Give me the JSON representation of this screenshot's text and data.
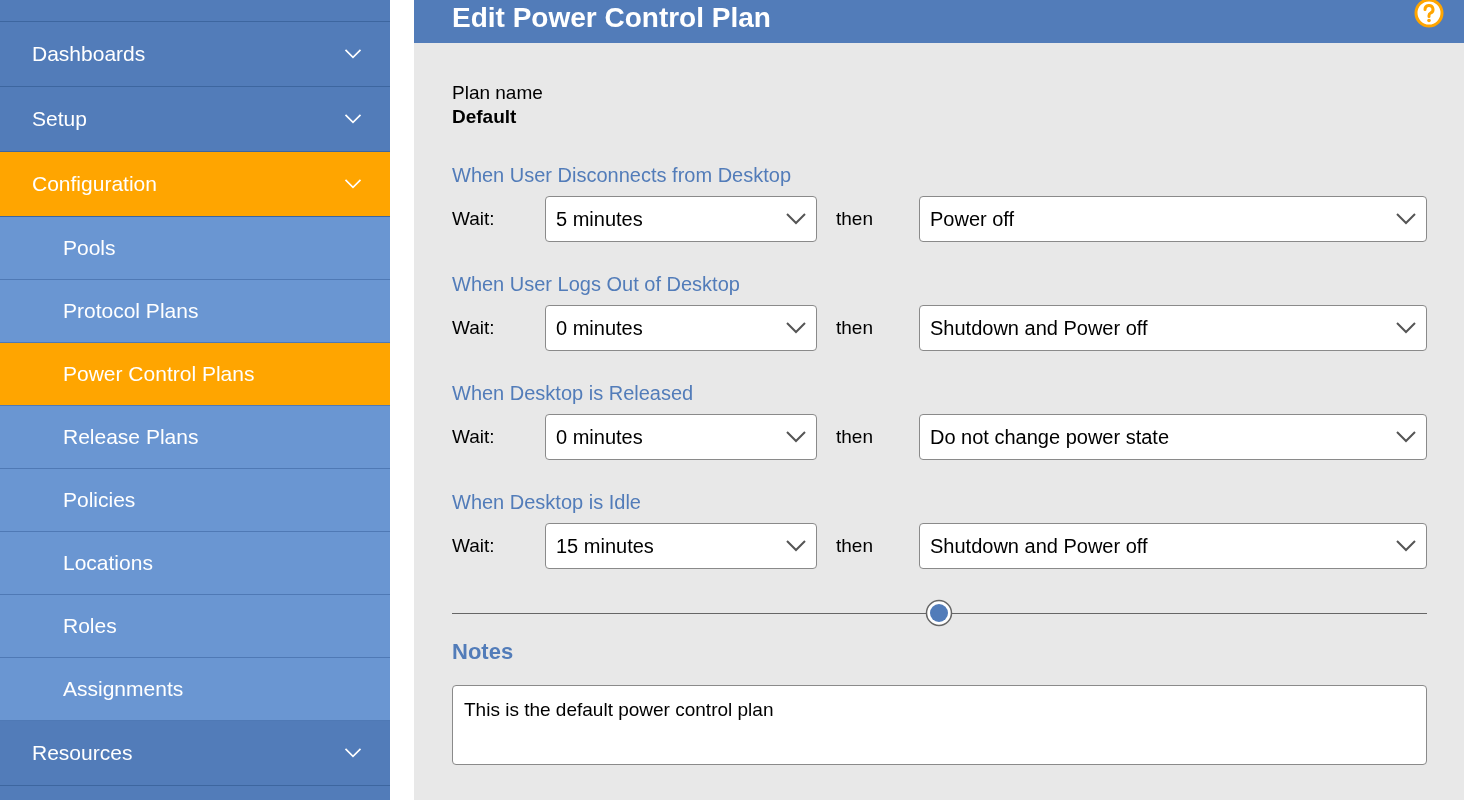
{
  "sidebar": {
    "items": [
      {
        "label": "Dashboards",
        "selected": false
      },
      {
        "label": "Setup",
        "selected": false
      },
      {
        "label": "Configuration",
        "selected": true,
        "children": [
          {
            "label": "Pools",
            "selected": false
          },
          {
            "label": "Protocol Plans",
            "selected": false
          },
          {
            "label": "Power Control Plans",
            "selected": true
          },
          {
            "label": "Release Plans",
            "selected": false
          },
          {
            "label": "Policies",
            "selected": false
          },
          {
            "label": "Locations",
            "selected": false
          },
          {
            "label": "Roles",
            "selected": false
          },
          {
            "label": "Assignments",
            "selected": false
          }
        ]
      },
      {
        "label": "Resources",
        "selected": false
      }
    ]
  },
  "header": {
    "title": "Edit Power Control Plan"
  },
  "plan": {
    "label": "Plan name",
    "value": "Default"
  },
  "sections": [
    {
      "heading": "When User Disconnects from Desktop",
      "wait_label": "Wait:",
      "wait": "5 minutes",
      "then_label": "then",
      "action": "Power off"
    },
    {
      "heading": "When User Logs Out of Desktop",
      "wait_label": "Wait:",
      "wait": "0 minutes",
      "then_label": "then",
      "action": "Shutdown and Power off"
    },
    {
      "heading": "When Desktop is Released",
      "wait_label": "Wait:",
      "wait": "0 minutes",
      "then_label": "then",
      "action": "Do not change power state"
    },
    {
      "heading": "When Desktop is Idle",
      "wait_label": "Wait:",
      "wait": "15 minutes",
      "then_label": "then",
      "action": "Shutdown and Power off"
    }
  ],
  "notes": {
    "heading": "Notes",
    "value": "This is the default power control plan"
  }
}
